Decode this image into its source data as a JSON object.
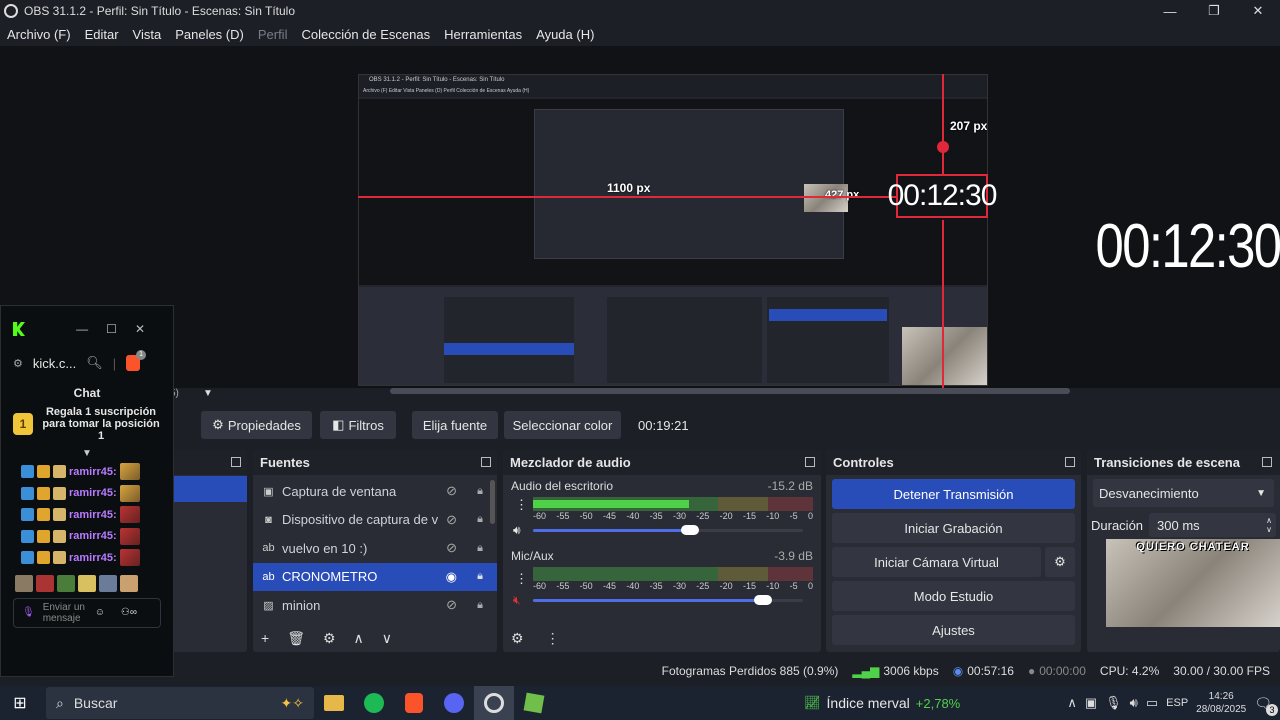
{
  "window": {
    "title": "OBS 31.1.2 - Perfil: Sin Título - Escenas: Sin Título"
  },
  "menu": [
    "Archivo (F)",
    "Editar",
    "Vista",
    "Paneles (D)",
    "Perfil",
    "Colección de Escenas",
    "Herramientas",
    "Ayuda (H)"
  ],
  "preview": {
    "timer_text": "00:12:30",
    "label_207": "207 px",
    "label_1100": "1100 px",
    "label_427": "427 px",
    "cat_caption": "QUIERO CHATEAR",
    "inner_title": "OBS 31.1.2 - Perfil: Sin Título - Escenas: Sin Título",
    "inner_menu": "Archivo (F)   Editar   Vista   Paneles (D)   Perfil   Colección de Escenas   Ayuda (H)"
  },
  "kick": {
    "url": "kick.c...",
    "chat_title": "Chat",
    "pinned_rank": "1",
    "pinned_text": "Regala 1 suscripción para tomar la posición 1",
    "messages": [
      {
        "user": "ramirr45:"
      },
      {
        "user": "ramirr45:"
      },
      {
        "user": "ramirr45:"
      },
      {
        "user": "ramirr45:"
      },
      {
        "user": "ramirr45:"
      }
    ],
    "input_placeholder": "Enviar un mensaje",
    "brave_badge": "1"
  },
  "toolbar": {
    "properties": "Propiedades",
    "filters": "Filtros",
    "pick_source": "Elija fuente",
    "pick_color": "Seleccionar color",
    "time": "00:19:21",
    "scene_label": "5)"
  },
  "sources": {
    "title": "Fuentes",
    "items": [
      {
        "name": "Captura de ventana",
        "icon": "window-icon"
      },
      {
        "name": "Dispositivo de captura de v",
        "icon": "camera-icon"
      },
      {
        "name": "vuelvo en 10 :)",
        "icon": "text-icon"
      },
      {
        "name": "CRONOMETRO",
        "icon": "text-icon"
      },
      {
        "name": "minion",
        "icon": "image-icon"
      }
    ]
  },
  "mixer": {
    "title": "Mezclador de audio",
    "channels": [
      {
        "name": "Audio del escritorio",
        "db": "-15.2 dB",
        "level": 0.62,
        "volume": 0.58
      },
      {
        "name": "Mic/Aux",
        "db": "-3.9 dB",
        "level": 0.0,
        "volume": 0.85
      }
    ],
    "scale": [
      "-60",
      "-55",
      "-50",
      "-45",
      "-40",
      "-35",
      "-30",
      "-25",
      "-20",
      "-15",
      "-10",
      "-5",
      "0"
    ]
  },
  "controls": {
    "title": "Controles",
    "stop_stream": "Detener Transmisión",
    "start_recording": "Iniciar Grabación",
    "start_virtual_cam": "Iniciar Cámara Virtual",
    "studio_mode": "Modo Estudio",
    "settings": "Ajustes"
  },
  "transitions": {
    "title": "Transiciones de escena",
    "selected": "Desvanecimiento",
    "duration_label": "Duración",
    "duration_value": "300 ms",
    "cat_caption": "QUIERO CHATEAR"
  },
  "status": {
    "dropped_frames": "Fotogramas Perdidos 885 (0.9%)",
    "bitrate": "3006 kbps",
    "stream_time": "00:57:16",
    "rec_time": "00:00:00",
    "cpu": "CPU: 4.2%",
    "fps": "30.00 / 30.00 FPS"
  },
  "taskbar": {
    "search": "Buscar",
    "stock_name": "Índice merval",
    "stock_change": "+2,78%",
    "lang": "ESP",
    "time": "14:26",
    "date": "28/08/2025",
    "notif_count": "3"
  },
  "colors": {
    "accent": "#284cb8",
    "red_guide": "#e0283a",
    "kick_green": "#53fc18",
    "meter_green": "#4fd14a",
    "meter_yellow": "#c7b23c",
    "meter_red": "#c44444"
  }
}
